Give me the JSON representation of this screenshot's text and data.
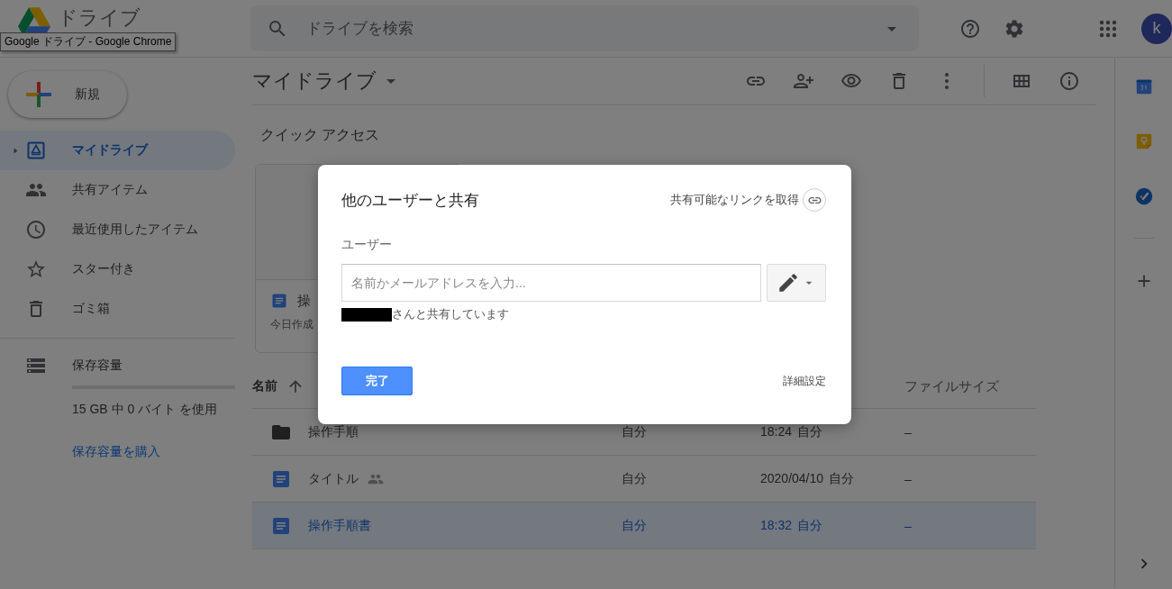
{
  "header": {
    "logo_text": "ドライブ",
    "tooltip": "Google ドライブ - Google Chrome",
    "search": {
      "placeholder": "ドライブを検索"
    },
    "avatar_letter": "k"
  },
  "sidebar": {
    "new_button": "新規",
    "items": [
      {
        "label": "マイドライブ",
        "kind": "drive",
        "selected": true
      },
      {
        "label": "共有アイテム",
        "kind": "shared",
        "selected": false
      },
      {
        "label": "最近使用したアイテム",
        "kind": "recent",
        "selected": false
      },
      {
        "label": "スター付き",
        "kind": "starred",
        "selected": false
      },
      {
        "label": "ゴミ箱",
        "kind": "trash",
        "selected": false
      }
    ],
    "storage": {
      "label": "保存容量",
      "level": 0,
      "usage": "15 GB 中 0 バイト を使用",
      "buy_link": "保存容量を購入"
    }
  },
  "main": {
    "title": "マイドライブ",
    "quick_access": {
      "heading": "クイック アクセス",
      "card": {
        "name": "操",
        "meta": "今日作成"
      }
    },
    "table": {
      "columns": {
        "name": "名前",
        "size": "ファイルサイズ"
      },
      "rows": [
        {
          "kind": "folder",
          "name": "操作手順",
          "shared": false,
          "owner": "自分",
          "modified_time": "18:24",
          "modified_by": "自分",
          "size": "–",
          "selected": false
        },
        {
          "kind": "doc",
          "name": "タイトル",
          "shared": true,
          "owner": "自分",
          "modified_time": "2020/04/10",
          "modified_by": "自分",
          "size": "–",
          "selected": false
        },
        {
          "kind": "doc",
          "name": "操作手順書",
          "shared": false,
          "owner": "自分",
          "modified_time": "18:32",
          "modified_by": "自分",
          "size": "–",
          "selected": true
        }
      ]
    }
  },
  "dialog": {
    "title": "他のユーザーと共有",
    "link_text": "共有可能なリンクを取得",
    "users_label": "ユーザー",
    "input": {
      "placeholder": "名前かメールアドレスを入力..."
    },
    "shared_note": "さんと共有しています",
    "done": "完了",
    "advanced": "詳細設定"
  }
}
